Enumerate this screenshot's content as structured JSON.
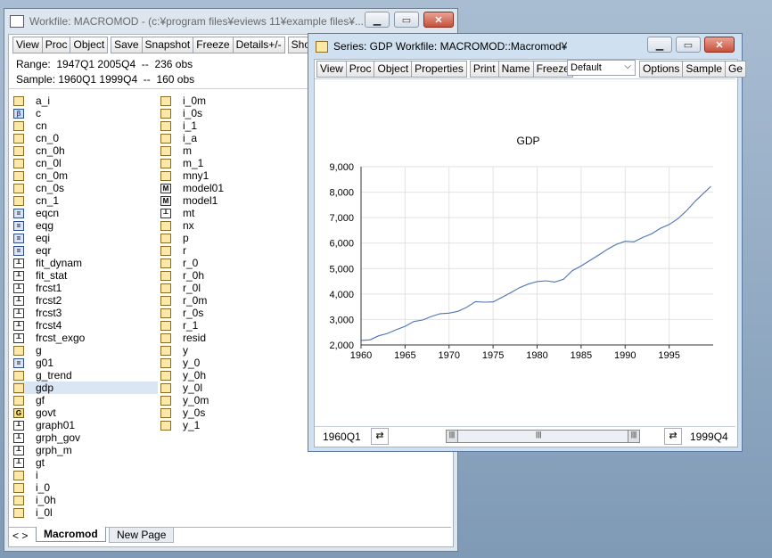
{
  "workfile_window": {
    "title": "Workfile: MACROMOD - (c:¥program files¥eviews 11¥example files¥...",
    "toolbar": [
      "View",
      "Proc",
      "Object",
      "Save",
      "Snapshot",
      "Freeze",
      "Details+/-",
      "Show"
    ],
    "range_label": "Range:",
    "range_value": "1947Q1 2005Q4",
    "range_obs": "236 obs",
    "sample_label": "Sample:",
    "sample_value": "1960Q1 1999Q4",
    "sample_obs": "160 obs",
    "col1": [
      {
        "name": "a_i",
        "icon": "series"
      },
      {
        "name": "c",
        "icon": "coef"
      },
      {
        "name": "cn",
        "icon": "series"
      },
      {
        "name": "cn_0",
        "icon": "series"
      },
      {
        "name": "cn_0h",
        "icon": "series"
      },
      {
        "name": "cn_0l",
        "icon": "series"
      },
      {
        "name": "cn_0m",
        "icon": "series"
      },
      {
        "name": "cn_0s",
        "icon": "series"
      },
      {
        "name": "cn_1",
        "icon": "series"
      },
      {
        "name": "eqcn",
        "icon": "equation"
      },
      {
        "name": "eqg",
        "icon": "equation"
      },
      {
        "name": "eqi",
        "icon": "equation"
      },
      {
        "name": "eqr",
        "icon": "equation"
      },
      {
        "name": "fit_dynam",
        "icon": "graph"
      },
      {
        "name": "fit_stat",
        "icon": "graph"
      },
      {
        "name": "frcst1",
        "icon": "graph"
      },
      {
        "name": "frcst2",
        "icon": "graph"
      },
      {
        "name": "frcst3",
        "icon": "graph"
      },
      {
        "name": "frcst4",
        "icon": "graph"
      },
      {
        "name": "frcst_exgo",
        "icon": "graph"
      },
      {
        "name": "g",
        "icon": "series"
      },
      {
        "name": "g01",
        "icon": "equation"
      },
      {
        "name": "g_trend",
        "icon": "series"
      },
      {
        "name": "gdp",
        "icon": "series"
      },
      {
        "name": "gf",
        "icon": "series"
      },
      {
        "name": "govt",
        "icon": "group"
      },
      {
        "name": "graph01",
        "icon": "graph"
      },
      {
        "name": "grph_gov",
        "icon": "graph"
      },
      {
        "name": "grph_m",
        "icon": "graph"
      },
      {
        "name": "gt",
        "icon": "graph"
      },
      {
        "name": "i",
        "icon": "series"
      },
      {
        "name": "i_0",
        "icon": "series"
      },
      {
        "name": "i_0h",
        "icon": "series"
      },
      {
        "name": "i_0l",
        "icon": "series"
      }
    ],
    "col2": [
      {
        "name": "i_0m",
        "icon": "series"
      },
      {
        "name": "i_0s",
        "icon": "series"
      },
      {
        "name": "i_1",
        "icon": "series"
      },
      {
        "name": "i_a",
        "icon": "series"
      },
      {
        "name": "m",
        "icon": "series"
      },
      {
        "name": "m_1",
        "icon": "series"
      },
      {
        "name": "mny1",
        "icon": "series"
      },
      {
        "name": "model01",
        "icon": "model"
      },
      {
        "name": "model1",
        "icon": "model"
      },
      {
        "name": "mt",
        "icon": "graph"
      },
      {
        "name": "nx",
        "icon": "series"
      },
      {
        "name": "p",
        "icon": "series"
      },
      {
        "name": "r",
        "icon": "series"
      },
      {
        "name": "r_0",
        "icon": "series"
      },
      {
        "name": "r_0h",
        "icon": "series"
      },
      {
        "name": "r_0l",
        "icon": "series"
      },
      {
        "name": "r_0m",
        "icon": "series"
      },
      {
        "name": "r_0s",
        "icon": "series"
      },
      {
        "name": "r_1",
        "icon": "series"
      },
      {
        "name": "resid",
        "icon": "series"
      },
      {
        "name": "y",
        "icon": "series"
      },
      {
        "name": "y_0",
        "icon": "series"
      },
      {
        "name": "y_0h",
        "icon": "series"
      },
      {
        "name": "y_0l",
        "icon": "series"
      },
      {
        "name": "y_0m",
        "icon": "series"
      },
      {
        "name": "y_0s",
        "icon": "series"
      },
      {
        "name": "y_1",
        "icon": "series"
      }
    ],
    "selected": "gdp",
    "tabs": {
      "nav": "< >",
      "active": "Macromod",
      "other": "New Page"
    }
  },
  "series_window": {
    "title": "Series: GDP   Workfile: MACROMOD::Macromod¥",
    "toolbar": [
      "View",
      "Proc",
      "Object",
      "Properties",
      "Print",
      "Name",
      "Freeze"
    ],
    "dropdown": "Default",
    "toolbar_right": [
      "Options",
      "Sample",
      "Ge"
    ],
    "status_left": "1960Q1",
    "status_right": "1999Q4"
  },
  "chart_data": {
    "type": "line",
    "title": "GDP",
    "xlim": [
      1960,
      2000
    ],
    "ylim": [
      2000,
      9000
    ],
    "xticks": [
      1960,
      1965,
      1970,
      1975,
      1980,
      1985,
      1990,
      1995
    ],
    "yticks": [
      2000,
      3000,
      4000,
      5000,
      6000,
      7000,
      8000,
      9000
    ],
    "ytick_labels": [
      "2,000",
      "3,000",
      "4,000",
      "5,000",
      "6,000",
      "7,000",
      "8,000",
      "9,000"
    ],
    "grid": true,
    "series": [
      {
        "x": [
          1960,
          1961,
          1962,
          1963,
          1964,
          1965,
          1966,
          1967,
          1968,
          1969,
          1970,
          1971,
          1972,
          1973,
          1974,
          1975,
          1976,
          1977,
          1978,
          1979,
          1980,
          1981,
          1982,
          1983,
          1984,
          1985,
          1986,
          1987,
          1988,
          1989,
          1990,
          1991,
          1992,
          1993,
          1994,
          1995,
          1996,
          1997,
          1998,
          1999.75
        ],
        "values": [
          2180,
          2200,
          2360,
          2450,
          2600,
          2730,
          2920,
          2980,
          3120,
          3230,
          3250,
          3320,
          3480,
          3700,
          3680,
          3690,
          3870,
          4050,
          4250,
          4390,
          4490,
          4520,
          4470,
          4580,
          4920,
          5100,
          5320,
          5530,
          5760,
          5950,
          6070,
          6050,
          6220,
          6360,
          6580,
          6730,
          6960,
          7280,
          7660,
          8230
        ],
        "color": "#4a74b4"
      }
    ]
  }
}
